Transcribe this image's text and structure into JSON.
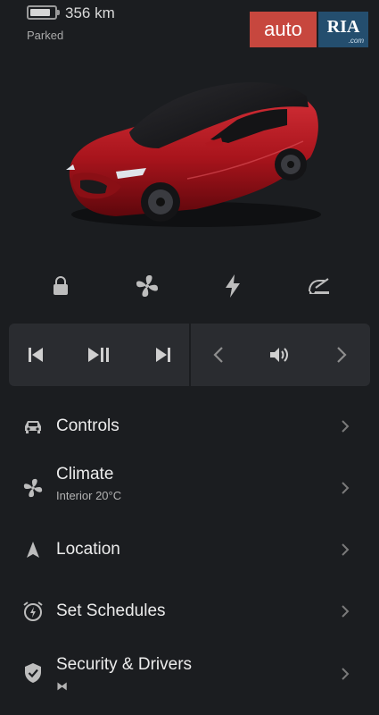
{
  "status": {
    "range": "356 km",
    "state": "Parked",
    "battery_level": 0.85
  },
  "watermark": {
    "left": "auto",
    "right_main": "RIA",
    "right_sub": ".com"
  },
  "quick_actions": [
    {
      "id": "lock",
      "icon": "lock-icon"
    },
    {
      "id": "climate",
      "icon": "fan-icon"
    },
    {
      "id": "charge",
      "icon": "lightning-icon"
    },
    {
      "id": "frunk",
      "icon": "frunk-icon"
    }
  ],
  "media": {
    "icons": [
      "previous-track-icon",
      "play-pause-icon",
      "next-track-icon",
      "chevron-left-icon",
      "volume-icon",
      "chevron-right-icon"
    ]
  },
  "menu": [
    {
      "title": "Controls",
      "subtitle": "",
      "icon": "car-icon"
    },
    {
      "title": "Climate",
      "subtitle": "Interior 20°C",
      "icon": "fan-icon"
    },
    {
      "title": "Location",
      "subtitle": "",
      "icon": "location-arrow-icon"
    },
    {
      "title": "Set Schedules",
      "subtitle": "",
      "icon": "alarm-bolt-icon"
    },
    {
      "title": "Security & Drivers",
      "subtitle": "⧓",
      "icon": "shield-check-icon"
    }
  ],
  "colors": {
    "background": "#1b1d20",
    "panel": "#2a2c30",
    "car_paint": "#b01820",
    "watermark_red": "#c7473e",
    "watermark_blue": "#244e6e"
  }
}
